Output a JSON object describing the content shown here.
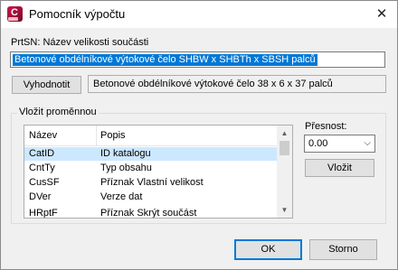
{
  "window": {
    "title": "Pomocník výpočtu",
    "app_icon": "app-logo-icon",
    "app_icon_letter": "C",
    "close_icon": "close-icon",
    "close_glyph": "✕"
  },
  "expression": {
    "label": "PrtSN: Název velikosti součásti",
    "value": "Betonové obdélníkové výtokové čelo SHBW x SHBTh x SBSH palců"
  },
  "evaluate": {
    "button_label": "Vyhodnotit",
    "result": "Betonové obdélníkové výtokové čelo 38 x 6 x 37 palců"
  },
  "variables": {
    "group_label": "Vložit proměnnou",
    "columns": [
      "Název",
      "Popis"
    ],
    "rows": [
      {
        "name": "CatID",
        "desc": "ID katalogu",
        "selected": true
      },
      {
        "name": "CntTy",
        "desc": "Typ obsahu",
        "selected": false
      },
      {
        "name": "CusSF",
        "desc": "Příznak Vlastní velikost",
        "selected": false
      },
      {
        "name": "DVer",
        "desc": "Verze dat",
        "selected": false
      },
      {
        "name": "HRptF",
        "desc": "Příznak Skrýt součást",
        "selected": false
      }
    ],
    "scroll_up_icon": "▲",
    "scroll_down_icon": "▼"
  },
  "precision": {
    "label": "Přesnost:",
    "value": "0.00",
    "chevron": "⌵"
  },
  "insert": {
    "button_label": "Vložit"
  },
  "footer": {
    "ok_label": "OK",
    "cancel_label": "Storno"
  },
  "colors": {
    "selection": "#0078d7",
    "row_selected": "#cce8ff",
    "app_icon": "#c9154a"
  }
}
